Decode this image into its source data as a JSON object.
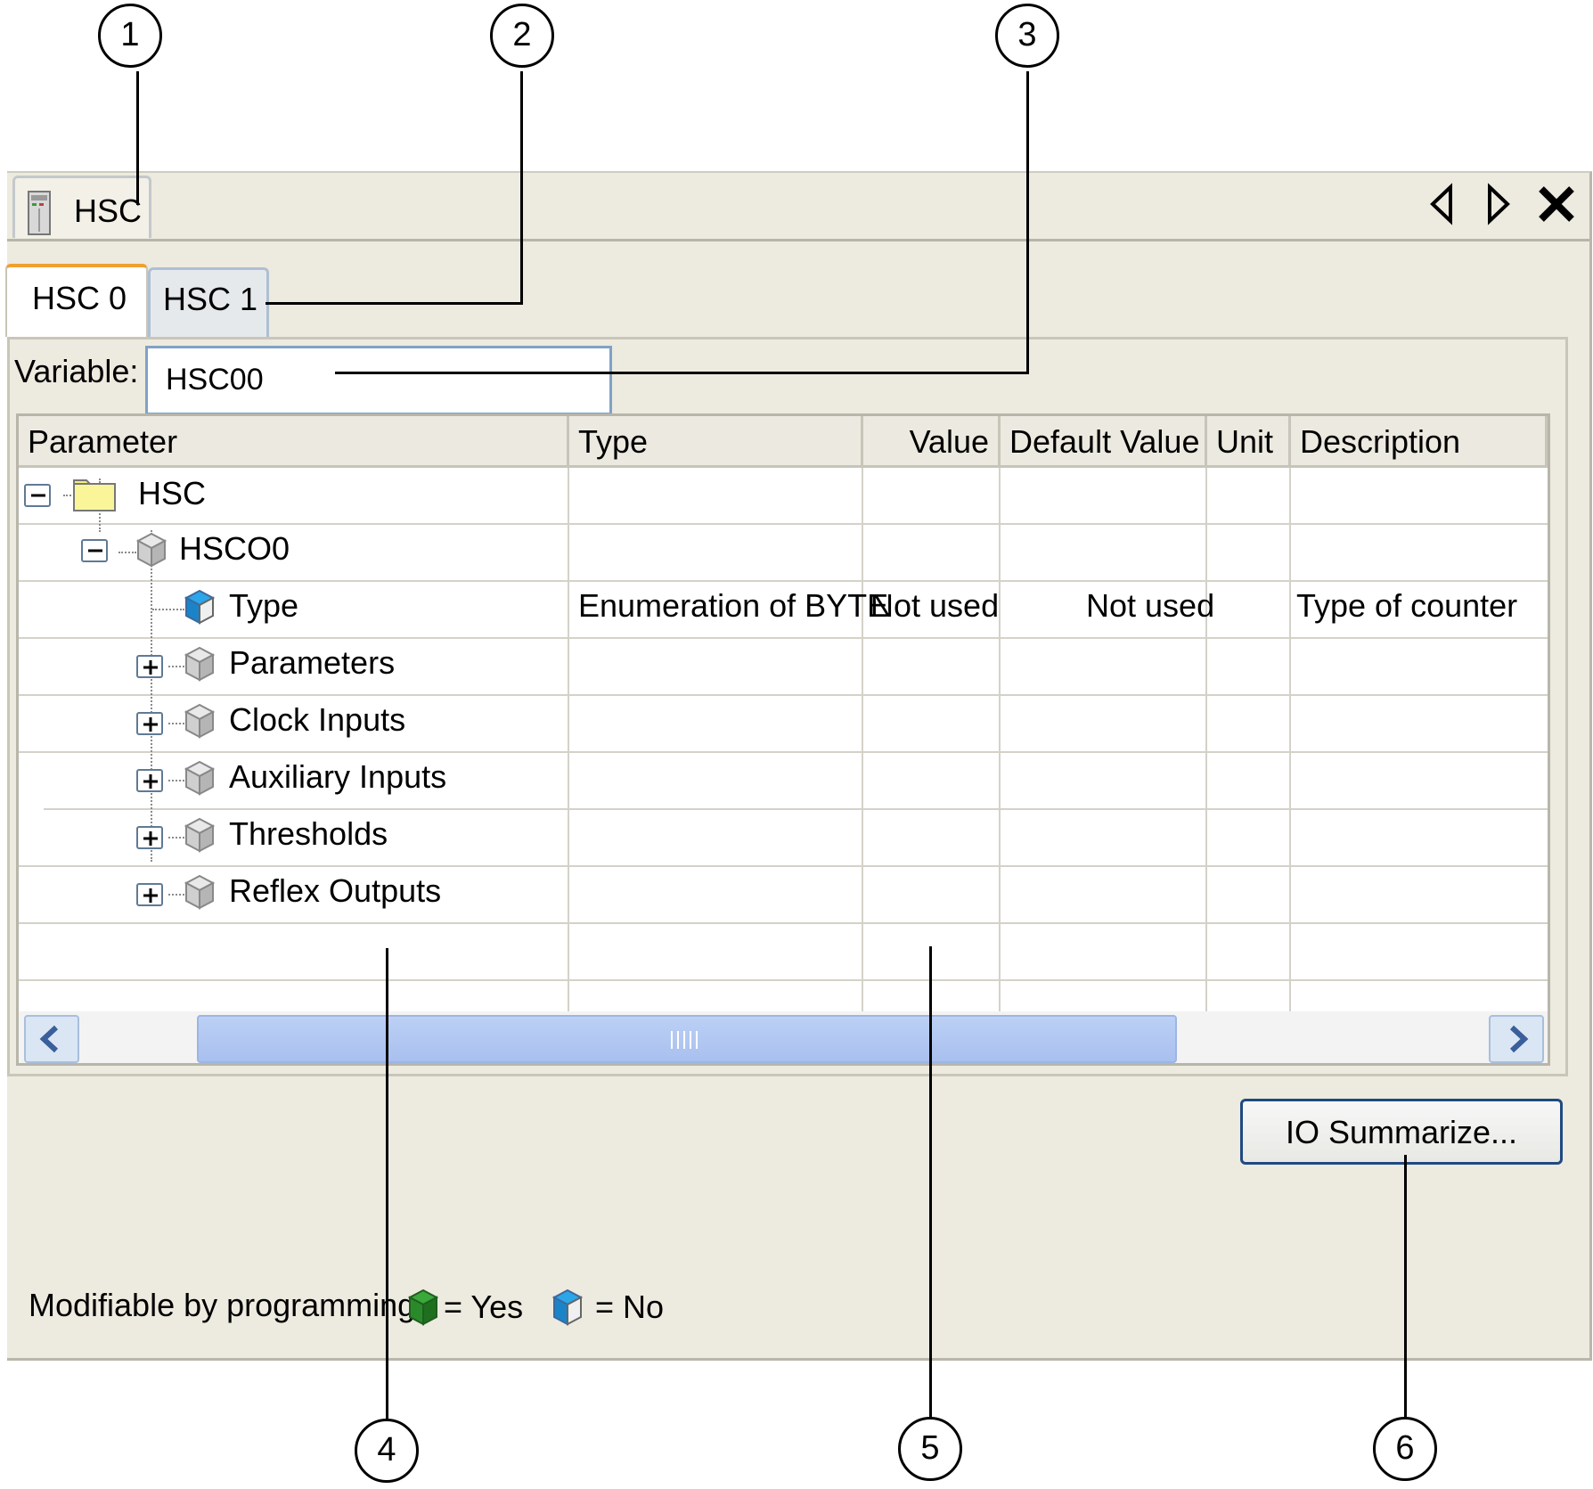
{
  "doc_tab": {
    "label": "HSC",
    "icon": "controller-device-icon"
  },
  "window_controls": {
    "prev": "triangle-left-icon",
    "next": "triangle-right-icon",
    "close": "close-icon"
  },
  "tabs": [
    {
      "label": "HSC 0",
      "active": true
    },
    {
      "label": "HSC 1",
      "active": false
    }
  ],
  "variable": {
    "label": "Variable:",
    "value": "HSC00"
  },
  "grid": {
    "columns": [
      "Parameter",
      "Type",
      "Value",
      "Default Value",
      "Unit",
      "Description"
    ],
    "rows": [
      {
        "name": "HSC",
        "icon": "folder-icon",
        "expander": "minus"
      },
      {
        "name": "HSCO0",
        "icon": "gray-cube-icon",
        "expander": "minus"
      },
      {
        "name": "Type",
        "icon": "blue-cube-icon",
        "type": "Enumeration of BYTE",
        "value": "Not used",
        "default": "Not used",
        "unit": "",
        "description": "Type of counter"
      },
      {
        "name": "Parameters",
        "icon": "gray-cube-icon",
        "expander": "plus"
      },
      {
        "name": "Clock Inputs",
        "icon": "gray-cube-icon",
        "expander": "plus"
      },
      {
        "name": "Auxiliary Inputs",
        "icon": "gray-cube-icon",
        "expander": "plus"
      },
      {
        "name": "Thresholds",
        "icon": "gray-cube-icon",
        "expander": "plus"
      },
      {
        "name": "Reflex Outputs",
        "icon": "gray-cube-icon",
        "expander": "plus"
      }
    ]
  },
  "io_button": {
    "label": "IO Summarize..."
  },
  "legend": {
    "label": "Modifiable by programming",
    "yes": "= Yes",
    "no": "= No"
  },
  "callouts": [
    "1",
    "2",
    "3",
    "4",
    "5",
    "6"
  ],
  "colors": {
    "window_bg": "#edeadf",
    "active_tab_accent": "#f0a030",
    "button_border": "#1f4a82",
    "scroll_thumb": "#bcd0f5"
  }
}
